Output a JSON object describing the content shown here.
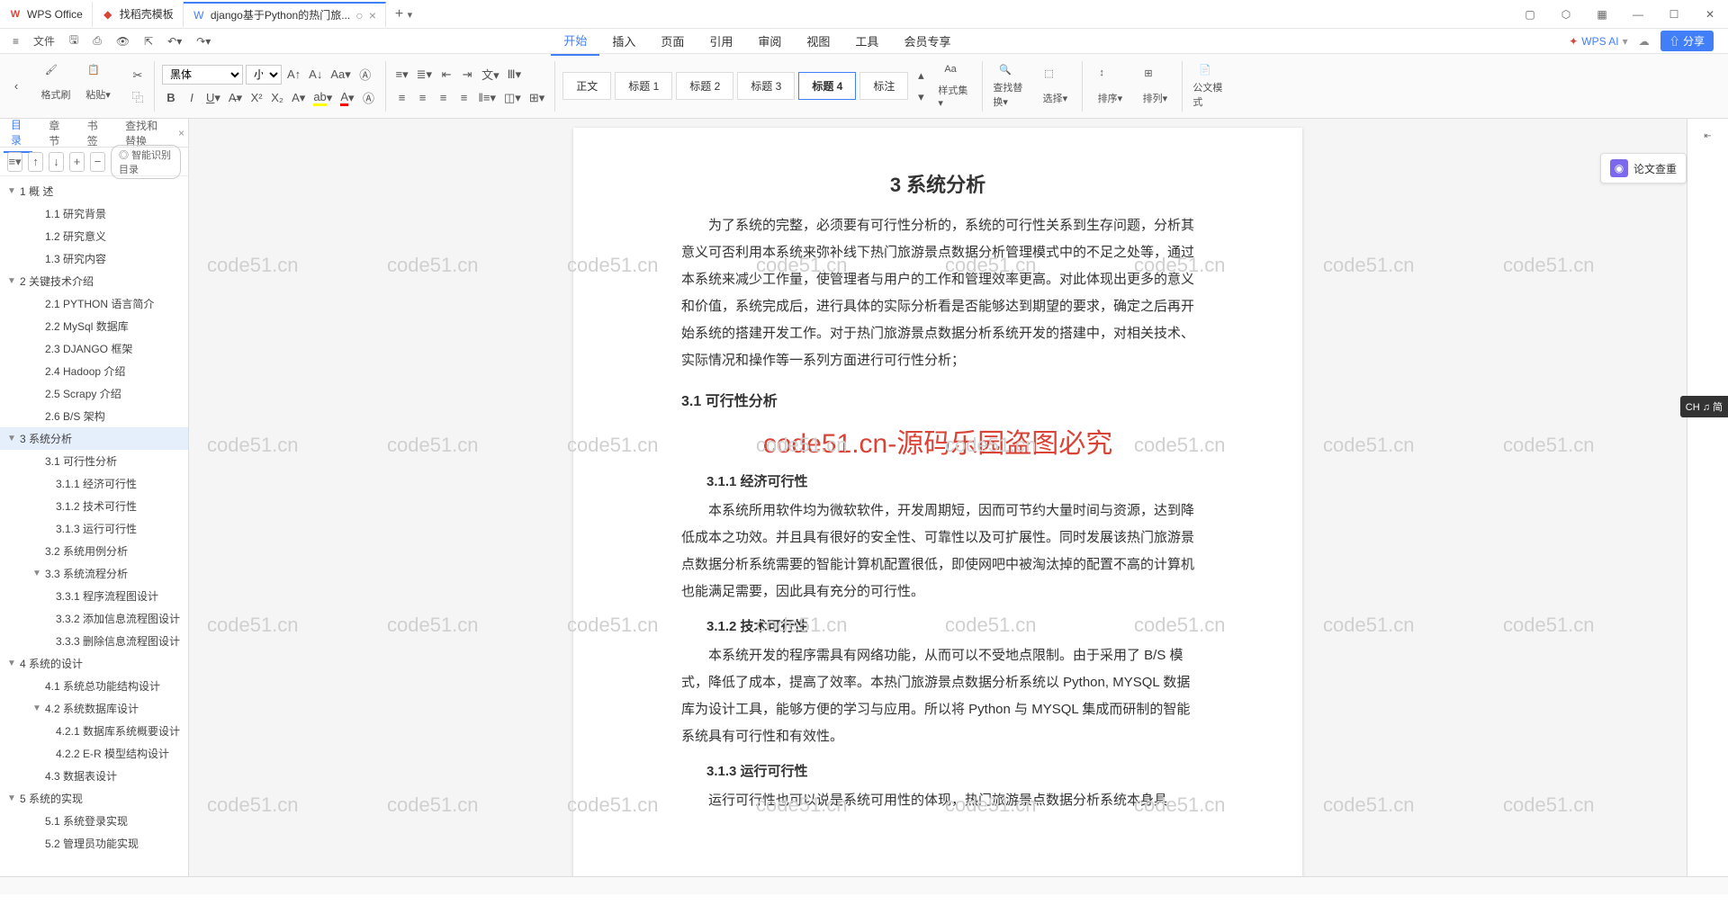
{
  "tabs": [
    {
      "icon": "wps",
      "label": "WPS Office"
    },
    {
      "icon": "docer",
      "label": "找稻壳模板"
    },
    {
      "icon": "word",
      "label": "django基于Python的热门旅...",
      "active": true
    }
  ],
  "quickbar": {
    "menu": "≡",
    "file": "文件"
  },
  "menu": [
    "开始",
    "插入",
    "页面",
    "引用",
    "审阅",
    "视图",
    "工具",
    "会员专享"
  ],
  "menu_active": 0,
  "wpsai": "WPS AI",
  "share": "⇧ 分享",
  "ribbon": {
    "format_brush": "格式刷",
    "paste": "粘贴",
    "font": "黑体",
    "size": "小三",
    "styles": [
      "正文",
      "标题 1",
      "标题 2",
      "标题 3",
      "标题 4",
      "标注"
    ],
    "style_sel": 4,
    "style_gallery": "样式集",
    "find": "查找替换",
    "select": "选择",
    "sort": "排序",
    "arrange": "排列",
    "mode": "公文模式"
  },
  "side": {
    "tabs": [
      "目录",
      "章节",
      "书签",
      "查找和替换"
    ],
    "active": 0,
    "smart": "智能识别目录",
    "toc": [
      {
        "l": 1,
        "t": "1  概    述",
        "chev": "▼"
      },
      {
        "l": 2,
        "t": "1.1 研究背景"
      },
      {
        "l": 2,
        "t": "1.2 研究意义"
      },
      {
        "l": 2,
        "t": "1.3 研究内容"
      },
      {
        "l": 1,
        "t": "2  关键技术介绍",
        "chev": "▼"
      },
      {
        "l": 2,
        "t": "2.1 PYTHON 语言简介"
      },
      {
        "l": 2,
        "t": "2.2 MySql 数据库"
      },
      {
        "l": 2,
        "t": "2.3 DJANGO 框架"
      },
      {
        "l": 2,
        "t": "2.4 Hadoop 介绍"
      },
      {
        "l": 2,
        "t": "2.5 Scrapy 介绍"
      },
      {
        "l": 2,
        "t": "2.6 B/S 架构"
      },
      {
        "l": 1,
        "t": "3  系统分析",
        "chev": "▼",
        "active": true
      },
      {
        "l": 2,
        "t": "3.1    可行性分析"
      },
      {
        "l": 3,
        "t": "3.1.1 经济可行性"
      },
      {
        "l": 3,
        "t": "3.1.2 技术可行性"
      },
      {
        "l": 3,
        "t": "3.1.3 运行可行性"
      },
      {
        "l": 2,
        "t": "3.2 系统用例分析"
      },
      {
        "l": 2,
        "t": "3.3 系统流程分析",
        "chev": "▼"
      },
      {
        "l": 3,
        "t": "3.3.1 程序流程图设计"
      },
      {
        "l": 3,
        "t": "3.3.2 添加信息流程图设计"
      },
      {
        "l": 3,
        "t": "3.3.3 删除信息流程图设计"
      },
      {
        "l": 1,
        "t": "4  系统的设计",
        "chev": "▼"
      },
      {
        "l": 2,
        "t": "4.1 系统总功能结构设计"
      },
      {
        "l": 2,
        "t": "4.2 系统数据库设计",
        "chev": "▼"
      },
      {
        "l": 3,
        "t": "4.2.1 数据库系统概要设计"
      },
      {
        "l": 3,
        "t": "4.2.2 E-R 模型结构设计"
      },
      {
        "l": 2,
        "t": "4.3 数据表设计"
      },
      {
        "l": 1,
        "t": "5  系统的实现",
        "chev": "▼"
      },
      {
        "l": 2,
        "t": "5.1 系统登录实现"
      },
      {
        "l": 2,
        "t": "5.2 管理员功能实现"
      }
    ]
  },
  "doc": {
    "h1": "3  系统分析",
    "p1": "为了系统的完整，必须要有可行性分析的，系统的可行性关系到生存问题，分析其意义可否利用本系统来弥补线下热门旅游景点数据分析管理模式中的不足之处等，通过本系统来减少工作量，使管理者与用户的工作和管理效率更高。对此体现出更多的意义和价值，系统完成后，进行具体的实际分析看是否能够达到期望的要求，确定之后再开始系统的搭建开发工作。对于热门旅游景点数据分析系统开发的搭建中，对相关技术、实际情况和操作等一系列方面进行可行性分析；",
    "h2_1": "3.1    可行性分析",
    "red": "code51.cn-源码乐园盗图必究",
    "h3_1": "3.1.1 经济可行性",
    "p2": "本系统所用软件均为微软软件，开发周期短，因而可节约大量时间与资源，达到降低成本之功效。并且具有很好的安全性、可靠性以及可扩展性。同时发展该热门旅游景点数据分析系统需要的智能计算机配置很低，即使网吧中被淘汰掉的配置不高的计算机也能满足需要，因此具有充分的可行性。",
    "h3_2": "3.1.2 技术可行性",
    "p3": "本系统开发的程序需具有网络功能，从而可以不受地点限制。由于采用了 B/S 模式，降低了成本，提高了效率。本热门旅游景点数据分析系统以 Python, MYSQL 数据库为设计工具，能够方便的学习与应用。所以将 Python 与 MYSQL 集成而研制的智能系统具有可行性和有效性。",
    "h3_3": "3.1.3 运行可行性",
    "p4": "运行可行性也可以说是系统可用性的体现，热门旅游景点数据分析系统本身具"
  },
  "rail": {
    "thesis": "论文查重",
    "ime": "CH ♫ 简"
  },
  "watermark": "code51.cn"
}
